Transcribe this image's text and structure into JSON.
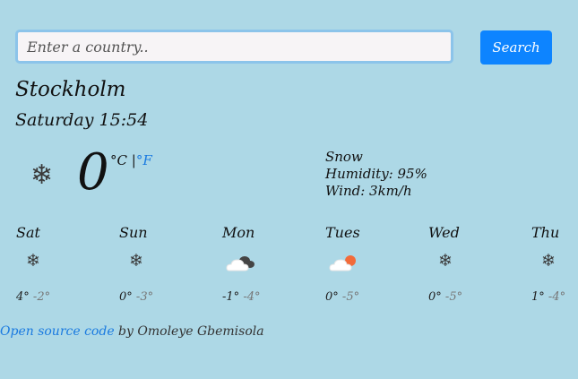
{
  "search": {
    "placeholder": "Enter a country..",
    "button_label": "Search"
  },
  "current": {
    "city": "Stockholm",
    "datetime": "Saturday 15:54",
    "icon": "snowflake-icon",
    "temperature": "0",
    "unit_celsius": "°C",
    "unit_separator": "|",
    "unit_fahrenheit": "°F",
    "description": "Snow",
    "humidity": "Humidity: 95%",
    "wind": "Wind: 3km/h"
  },
  "forecast": [
    {
      "day": "Sat",
      "icon": "snowflake-icon",
      "max": "4°",
      "min": "-2°"
    },
    {
      "day": "Sun",
      "icon": "snowflake-icon",
      "max": "0°",
      "min": "-3°"
    },
    {
      "day": "Mon",
      "icon": "cloudy-night-icon",
      "max": "-1°",
      "min": "-4°"
    },
    {
      "day": "Tues",
      "icon": "partly-cloudy-sun-icon",
      "max": "0°",
      "min": "-5°"
    },
    {
      "day": "Wed",
      "icon": "snowflake-icon",
      "max": "0°",
      "min": "-5°"
    },
    {
      "day": "Thu",
      "icon": "snowflake-icon",
      "max": "1°",
      "min": "-4°"
    }
  ],
  "footer": {
    "link_text": "Open source code",
    "credit": " by Omoleye Gbemisola"
  },
  "colors": {
    "background": "#add8e6",
    "accent": "#0d84ff",
    "link": "#1a7ae0"
  }
}
